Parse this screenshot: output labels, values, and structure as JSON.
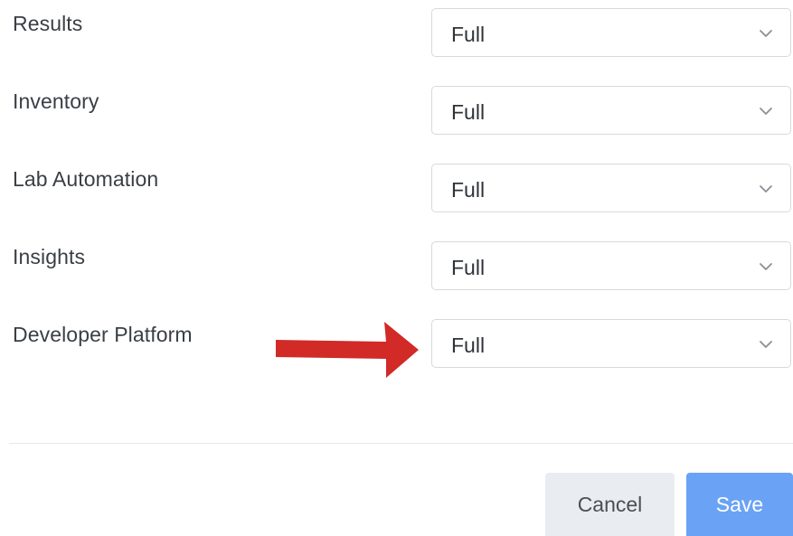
{
  "permissions": [
    {
      "label": "Results",
      "value": "Full"
    },
    {
      "label": "Inventory",
      "value": "Full"
    },
    {
      "label": "Lab Automation",
      "value": "Full"
    },
    {
      "label": "Insights",
      "value": "Full"
    },
    {
      "label": "Developer Platform",
      "value": "Full"
    }
  ],
  "footer": {
    "cancel_label": "Cancel",
    "save_label": "Save"
  },
  "icons": {
    "select_chevron": "chevron-down-icon",
    "annotation": "red-arrow-icon"
  },
  "colors": {
    "primary": "#6aa3f5",
    "annotation_arrow": "#d12a27",
    "label_text": "#3a3f45",
    "border": "#d6d9dd"
  }
}
